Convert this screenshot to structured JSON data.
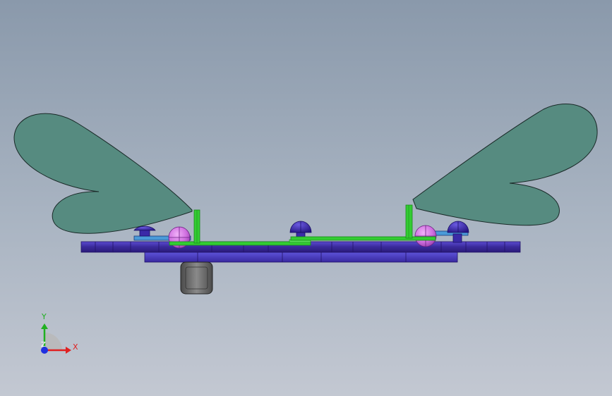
{
  "viewport": {
    "background_top": "#8a99ab",
    "background_bottom": "#c3c8d2"
  },
  "model": {
    "colors": {
      "wing_fill": "#568b80",
      "wing_edge": "#1a2a28",
      "frame": "#3a2a9a",
      "frame_light": "#5a4ad0",
      "bracket": "#33cc33",
      "bracket_dark": "#1a8a1a",
      "spacer": "#4a9ad8",
      "bolt": "#3a2aa8",
      "ball": "#d070e0",
      "motor": "#6e6e6e"
    }
  },
  "triad": {
    "x_label": "X",
    "y_label": "Y",
    "z_label": "Z",
    "x_color": "#e02020",
    "y_color": "#20b020",
    "z_color": "#2030e0"
  }
}
